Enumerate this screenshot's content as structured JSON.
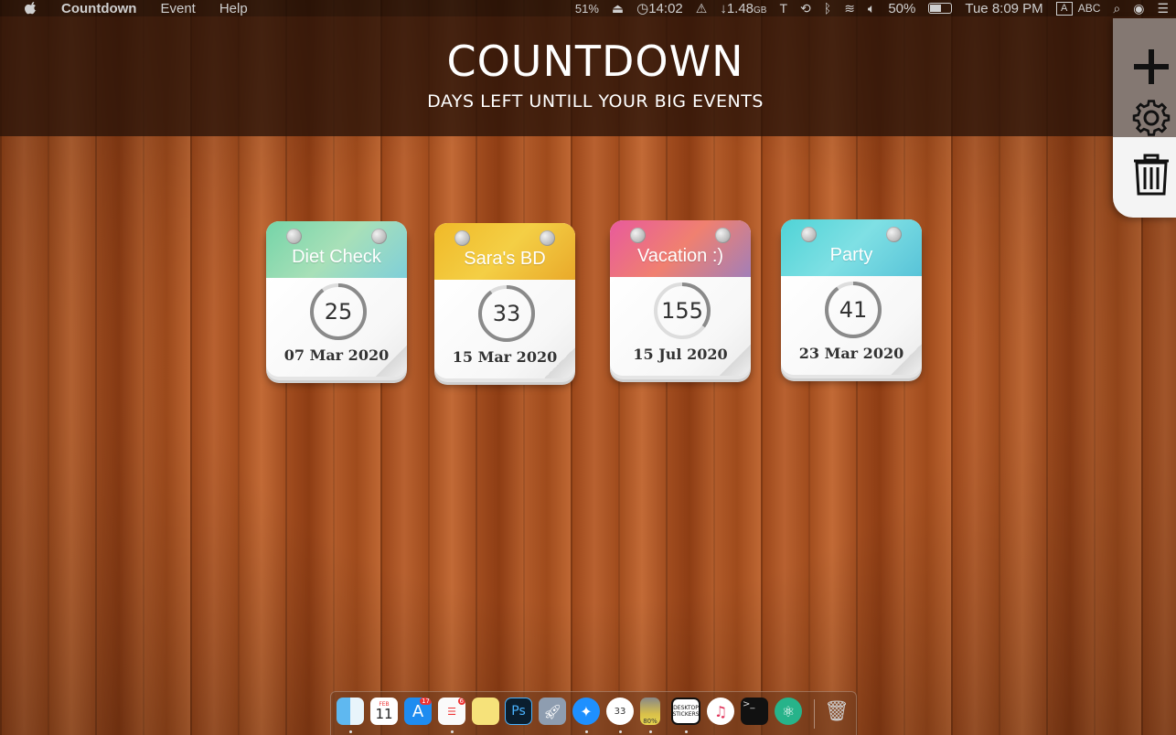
{
  "menubar": {
    "app_name": "Countdown",
    "menus": [
      "Event",
      "Help"
    ],
    "status": {
      "memory_pct": "51%",
      "clock": "14:02",
      "download": "↓1.48",
      "download_unit": "GB",
      "battery": "50%",
      "datetime": "Tue 8:09 PM",
      "input_letter": "A",
      "input_source": "ABC"
    }
  },
  "header": {
    "title": "COUNTDOWN",
    "subtitle": "DAYS LEFT UNTILL YOUR BIG EVENTS"
  },
  "toolbar": {
    "add": "plus-icon",
    "settings": "gear-icon",
    "delete": "trash-icon"
  },
  "events": [
    {
      "name": "Diet Check",
      "days": "25",
      "date": "07 Mar 2020",
      "progress": 0.9,
      "colors": [
        "#74d4a8",
        "#a8e0b8",
        "#7fcfd9"
      ]
    },
    {
      "name": "Sara's BD",
      "days": "33",
      "date": "15 Mar 2020",
      "progress": 0.9,
      "colors": [
        "#f0b928",
        "#f4cf45",
        "#e9a92a"
      ]
    },
    {
      "name": "Vacation :)",
      "days": "155",
      "date": "15 Jul 2020",
      "progress": 0.35,
      "colors": [
        "#e85a9c",
        "#f08070",
        "#a27fb8"
      ]
    },
    {
      "name": "Party",
      "days": "41",
      "date": "23 Mar 2020",
      "progress": 0.9,
      "colors": [
        "#4fd3d6",
        "#7fe0e4",
        "#58c3d8"
      ]
    }
  ],
  "dock": {
    "calendar_day": "11",
    "calendar_month": "FEB",
    "appstore_badge": "17",
    "reminders_badge": "6",
    "ps_label": "Ps",
    "countdown_label": "33",
    "battery_label": "80%",
    "stickers_label": "DESKTOP STICKERS",
    "terminal_label": ">_"
  },
  "colors": {
    "header_bg": "#28120850",
    "panel_bg": "#f4f4f4",
    "ring_track": "#dddddd",
    "ring_fill": "#8a8a8a"
  }
}
